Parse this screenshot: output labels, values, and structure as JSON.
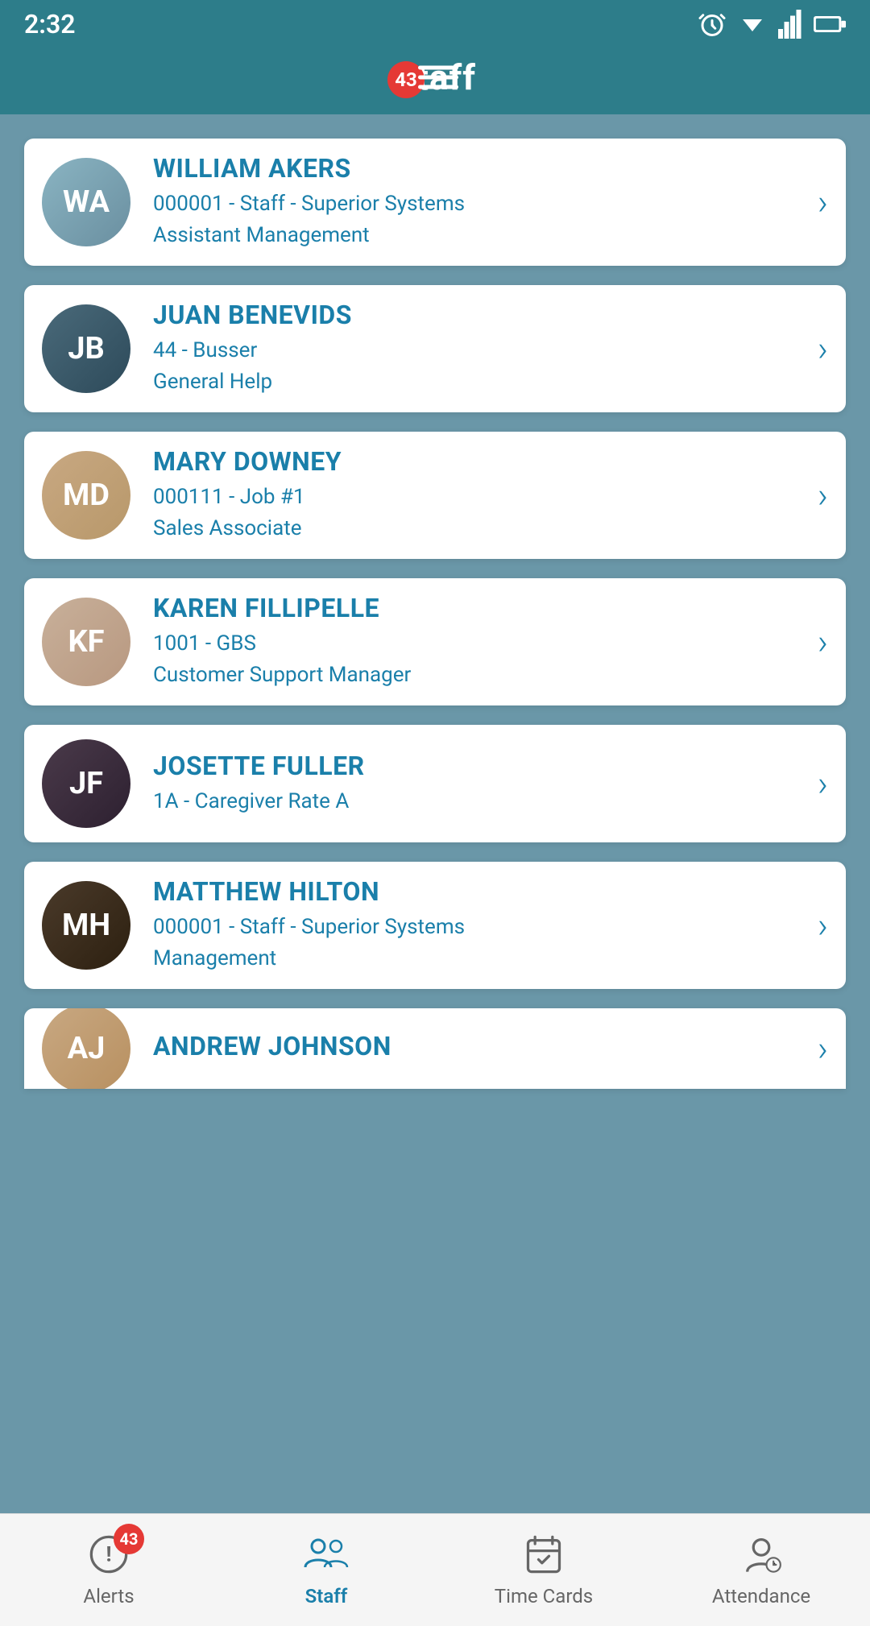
{
  "statusBar": {
    "time": "2:32"
  },
  "header": {
    "title": "Staff",
    "badgeCount": "43"
  },
  "staff": [
    {
      "id": "william-akers",
      "name": "WILLIAM AKERS",
      "detail1": "000001 - Staff - Superior Systems",
      "detail2": "Assistant Management",
      "initials": "WA",
      "avatarClass": "avatar-william"
    },
    {
      "id": "juan-benevids",
      "name": "JUAN BENEVIDS",
      "detail1": "44 - Busser",
      "detail2": "General Help",
      "initials": "JB",
      "avatarClass": "avatar-juan"
    },
    {
      "id": "mary-downey",
      "name": "MARY DOWNEY",
      "detail1": "000111 - Job #1",
      "detail2": "Sales Associate",
      "initials": "MD",
      "avatarClass": "avatar-mary"
    },
    {
      "id": "karen-fillipelle",
      "name": "KAREN FILLIPELLE",
      "detail1": "1001 - GBS",
      "detail2": "Customer Support Manager",
      "initials": "KF",
      "avatarClass": "avatar-karen"
    },
    {
      "id": "josette-fuller",
      "name": "JOSETTE FULLER",
      "detail1": "1A - Caregiver Rate A",
      "detail2": "",
      "initials": "JF",
      "avatarClass": "avatar-josette"
    },
    {
      "id": "matthew-hilton",
      "name": "MATTHEW HILTON",
      "detail1": "000001 - Staff - Superior Systems",
      "detail2": "Management",
      "initials": "MH",
      "avatarClass": "avatar-matthew"
    }
  ],
  "partialCard": {
    "name": "ANDREW JOHNSON",
    "initials": "AJ",
    "avatarClass": "avatar-andrew"
  },
  "bottomNav": [
    {
      "id": "alerts",
      "label": "Alerts",
      "badge": "43",
      "active": false
    },
    {
      "id": "staff",
      "label": "Staff",
      "badge": "",
      "active": true
    },
    {
      "id": "timecards",
      "label": "Time Cards",
      "badge": "",
      "active": false
    },
    {
      "id": "attendance",
      "label": "Attendance",
      "badge": "",
      "active": false
    }
  ],
  "colors": {
    "accent": "#1a7faa",
    "headerBg": "#2d7d8a",
    "contentBg": "#6a97a8",
    "alertRed": "#e53935"
  }
}
